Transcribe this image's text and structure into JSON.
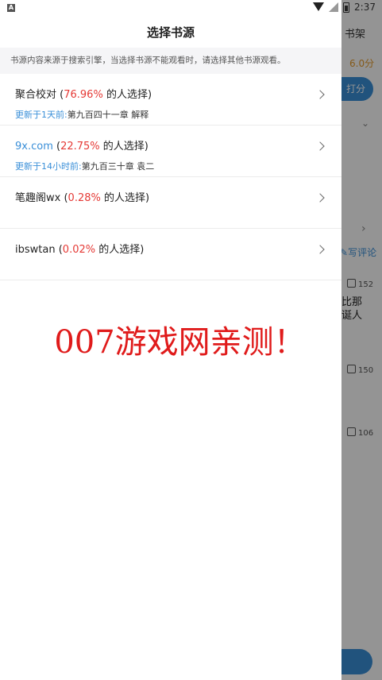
{
  "status_bar": {
    "left_icon": "A",
    "time": "2:37",
    "icons": [
      "wifi-icon",
      "signal-icon",
      "battery-icon"
    ]
  },
  "background_app": {
    "shelf_label": "书架",
    "score": "6.0分",
    "rate_button": "打分",
    "write_review": "写评论",
    "likes": [
      "152",
      "150",
      "106"
    ],
    "snippet": [
      "比那",
      "诞人"
    ]
  },
  "sheet": {
    "title": "选择书源",
    "notice": "书源内容来源于搜索引擎，当选择书源不能观看时，请选择其他书源观看。",
    "sources": [
      {
        "name": "聚合校对",
        "pct": "76.96%",
        "suffix": " 的人选择)",
        "prefix": " (",
        "link": false,
        "update_tag": "更新于1天前:",
        "update_text": "第九百四十一章 解释"
      },
      {
        "name": "9x.com",
        "pct": "22.75%",
        "suffix": " 的人选择)",
        "prefix": " (",
        "link": true,
        "update_tag": "更新于14小时前:",
        "update_text": "第九百三十章 袁二"
      },
      {
        "name": "笔趣阁wx",
        "pct": "0.28%",
        "suffix": " 的人选择)",
        "prefix": " (",
        "link": false,
        "update_tag": "",
        "update_text": ""
      },
      {
        "name": "ibswtan",
        "pct": "0.02%",
        "suffix": " 的人选择)",
        "prefix": " (",
        "link": false,
        "update_tag": "",
        "update_text": ""
      }
    ]
  },
  "watermark": "007游戏网亲测！",
  "colors": {
    "accent_blue": "#3a8fd8",
    "percent_red": "#e53935",
    "watermark_red": "#e01b1b",
    "score_orange": "#e59b2d"
  }
}
